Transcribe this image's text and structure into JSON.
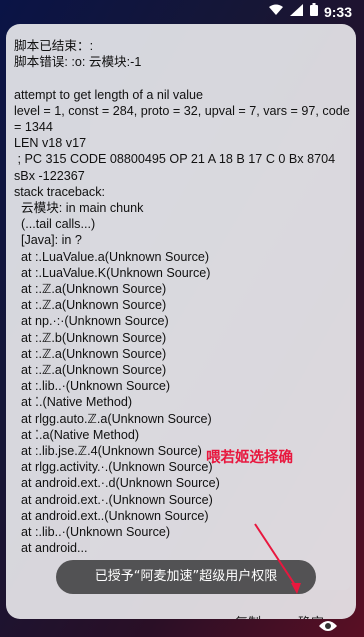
{
  "status_bar": {
    "time": "9:33",
    "icons": [
      "wifi-icon",
      "signal-icon",
      "battery-icon"
    ]
  },
  "dialog": {
    "error_lines": [
      "脚本已结束：:",
      "脚本错误: :o: 云模块:-1",
      "",
      "attempt to get length of a nil value",
      "level = 1, const = 284, proto = 32, upval = 7, vars = 97, code = 1344",
      "LEN v18 v17",
      " ; PC 315 CODE 08800495 OP 21 A 18 B 17 C 0 Bx 8704 sBx -122367",
      "stack traceback:",
      "  云模块: in main chunk",
      "  (...tail calls...)",
      "  [Java]: in ?",
      "  at :.LuaValue.a(Unknown Source)",
      "  at :.LuaValue.K(Unknown Source)",
      "  at :.ℤ.a(Unknown Source)",
      "  at :.ℤ.a(Unknown Source)",
      "  at np.·:·(Unknown Source)",
      "  at :.ℤ.b(Unknown Source)",
      "  at :.ℤ.a(Unknown Source)",
      "  at :.ℤ.a(Unknown Source)",
      "  at :.lib..·(Unknown Source)",
      "  at ⁚.(Native Method)",
      "  at rlgg.auto.ℤ.a(Unknown Source)",
      "  at ⁚.a(Native Method)",
      "  at :.lib.jse.ℤ.4(Unknown Source)",
      "  at rlgg.activity.·.(Unknown Source)",
      "  at android.ext.·.d(Unknown Source)",
      "  at android.ext.·.(Unknown Source)",
      "  at android.ext..(Unknown Source)",
      "  at :.lib..·(Unknown Source)",
      "  at android..."
    ],
    "annotation": "喂若姬选择确",
    "toast": "已授予“阿麦加速”超级用户权限",
    "copy_label": "复制",
    "ok_label": "确定"
  },
  "colors": {
    "annotation": "#e8173e",
    "dialog_bg": "#ececf0",
    "toast_bg": "#464648"
  },
  "bottom_icon": "eye-icon"
}
